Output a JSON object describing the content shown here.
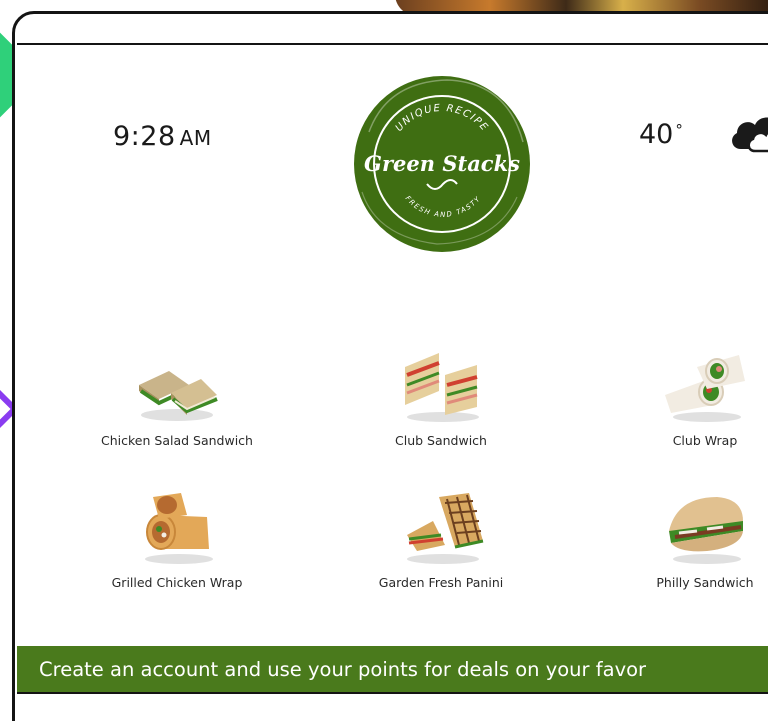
{
  "status_bar": {
    "time": "9:28",
    "ampm": "AM",
    "temperature": "40",
    "degree_symbol": "°",
    "weather_icon": "cloud-icon"
  },
  "logo": {
    "name": "Green Stacks",
    "tagline_top": "UNIQUE RECIPE",
    "tagline_bottom": "FRESH AND TASTY",
    "color": "#3f6e12"
  },
  "menu": {
    "items": [
      {
        "label": "Chicken Salad Sandwich",
        "icon": "sandwich-icon"
      },
      {
        "label": "Club Sandwich",
        "icon": "club-sandwich-icon"
      },
      {
        "label": "Club Wrap",
        "icon": "wrap-icon"
      },
      {
        "label": "Grilled Chicken Wrap",
        "icon": "wrap-icon"
      },
      {
        "label": "Garden Fresh Panini",
        "icon": "panini-icon"
      },
      {
        "label": "Philly Sandwich",
        "icon": "sub-sandwich-icon"
      }
    ]
  },
  "banner": {
    "text": "Create an account and use your points for deals on your favor",
    "color": "#4a7a1c"
  }
}
